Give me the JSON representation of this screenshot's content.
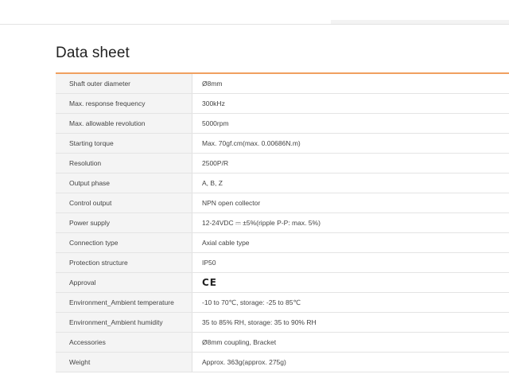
{
  "page": {
    "title": "Data sheet"
  },
  "datasheet": {
    "rows": [
      {
        "key": "Shaft outer diameter",
        "value": "Ø8mm"
      },
      {
        "key": "Max. response frequency",
        "value": "300kHz"
      },
      {
        "key": "Max. allowable revolution",
        "value": "5000rpm"
      },
      {
        "key": "Starting torque",
        "value": "Max. 70gf.cm(max. 0.00686N.m)"
      },
      {
        "key": "Resolution",
        "value": "2500P/R"
      },
      {
        "key": "Output phase",
        "value": "A, B, Z"
      },
      {
        "key": "Control output",
        "value": "NPN open collector"
      },
      {
        "key": "Power supply",
        "value": "12-24VDC ⎓ ±5%(ripple P-P: max. 5%)"
      },
      {
        "key": "Connection type",
        "value": "Axial cable type"
      },
      {
        "key": "Protection structure",
        "value": "IP50"
      },
      {
        "key": "Approval",
        "value": "CE",
        "icon": "ce-mark-icon"
      },
      {
        "key": "Environment_Ambient temperature",
        "value": "-10 to 70℃, storage: -25 to 85℃"
      },
      {
        "key": "Environment_Ambient humidity",
        "value": "35 to 85% RH, storage: 35 to 90% RH"
      },
      {
        "key": "Accessories",
        "value": "Ø8mm coupling, Bracket"
      },
      {
        "key": "Weight",
        "value": "Approx. 363g(approx. 275g)"
      }
    ]
  },
  "colors": {
    "accent": "#f0a060",
    "key_bg": "#f4f4f4",
    "border": "#e4e4e4"
  }
}
